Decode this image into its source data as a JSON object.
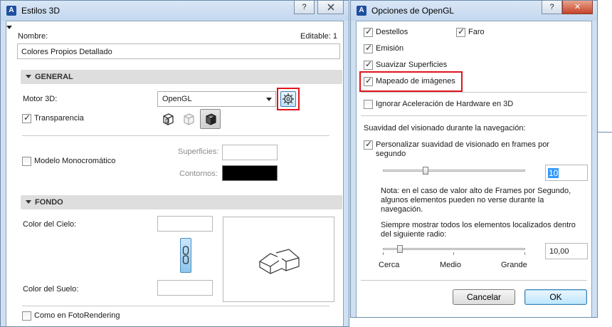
{
  "left_window": {
    "title": "Estilos 3D",
    "help_label": "?",
    "editable_label": "Editable: 1",
    "name_label": "Nombre:",
    "name_value": "Colores Propios Detallado",
    "general_section": {
      "title": "GENERAL",
      "engine_label": "Motor 3D:",
      "engine_value": "OpenGL",
      "transparency_label": "Transparencia",
      "transparency_checked": true,
      "mono_label": "Modelo Monocromático",
      "mono_checked": false,
      "surfaces_label": "Superficies:",
      "contours_label": "Contornos:",
      "contours_color": "#000000"
    },
    "background_section": {
      "title": "FONDO",
      "sky_label": "Color del Cielo:",
      "ground_label": "Color del Suelo:",
      "photorender_label": "Como en FotoRendering",
      "photorender_checked": false
    }
  },
  "right_window": {
    "title": "Opciones de OpenGL",
    "help_label": "?",
    "close_label": "✕",
    "checkboxes": {
      "destellos": {
        "label": "Destellos",
        "checked": true
      },
      "faro": {
        "label": "Faro",
        "checked": true
      },
      "emision": {
        "label": "Emisión",
        "checked": true
      },
      "suavizar": {
        "label": "Suavizar Superficies",
        "checked": true
      },
      "mapeado": {
        "label": "Mapeado de imágenes",
        "checked": true
      },
      "ignorar": {
        "label": "Ignorar Aceleración de Hardware en 3D",
        "checked": false
      },
      "personalizar": {
        "label_line1": "Personalizar suavidad de visionado en frames por",
        "label_line2": "segundo",
        "checked": true
      }
    },
    "nav_heading": "Suavidad del visionado durante la navegación:",
    "fps_value": "10",
    "fps_slider_fraction": 0.3,
    "note_lines": [
      "Nota: en el caso de valor alto de Frames por Segundo,",
      "algunos elementos pueden no verse durante la",
      "navegación."
    ],
    "radius_lines": [
      "Siempre mostrar todos los elementos localizados dentro",
      "del siguiente radio:"
    ],
    "radius_value": "10,00",
    "radius_slider_fraction": 0.12,
    "slider_labels": {
      "near": "Cerca",
      "mid": "Medio",
      "far": "Grande"
    },
    "cancel_label": "Cancelar",
    "ok_label": "OK"
  },
  "colors": {
    "highlight": "#e0141e",
    "accent": "#3c7fb1"
  }
}
